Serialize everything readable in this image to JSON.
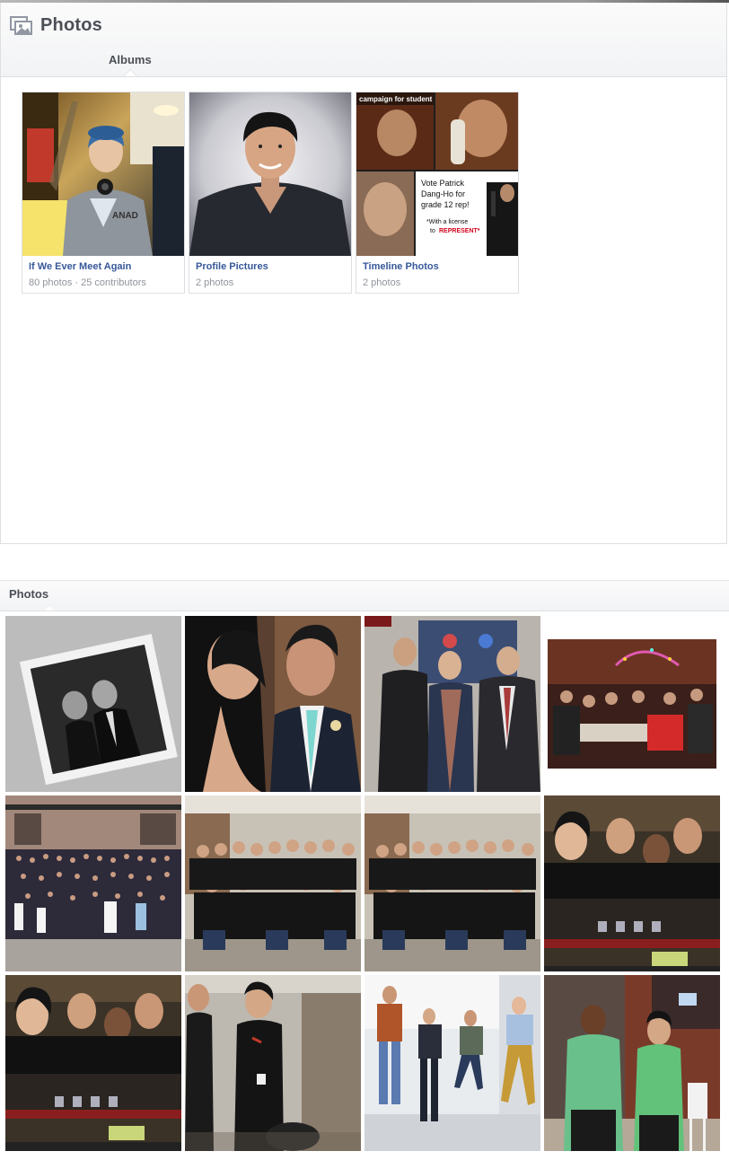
{
  "albums_section": {
    "title": "Photos",
    "tab": "Albums",
    "albums": [
      {
        "name": "If We Ever Meet Again",
        "meta": "80 photos · 25 contributors"
      },
      {
        "name": "Profile Pictures",
        "meta": "2 photos"
      },
      {
        "name": "Timeline Photos",
        "meta": "2 photos"
      }
    ],
    "timeline_cover": {
      "top_text": "campaign for student ... is ready, right?",
      "poster_line1": "Vote Patrick",
      "poster_line2": "Dang-Ho for",
      "poster_line3": "grade 12 rep!",
      "poster_line4": "*With a license",
      "poster_line5": "to",
      "poster_line6": "REPRESENT*",
      "accent": "#d0021b"
    }
  },
  "photos_section": {
    "title": "Photos",
    "tile_count": 12
  },
  "colors": {
    "link": "#365899",
    "meta": "#90949c",
    "heading": "#4b4f56",
    "border": "#dddfe2"
  }
}
